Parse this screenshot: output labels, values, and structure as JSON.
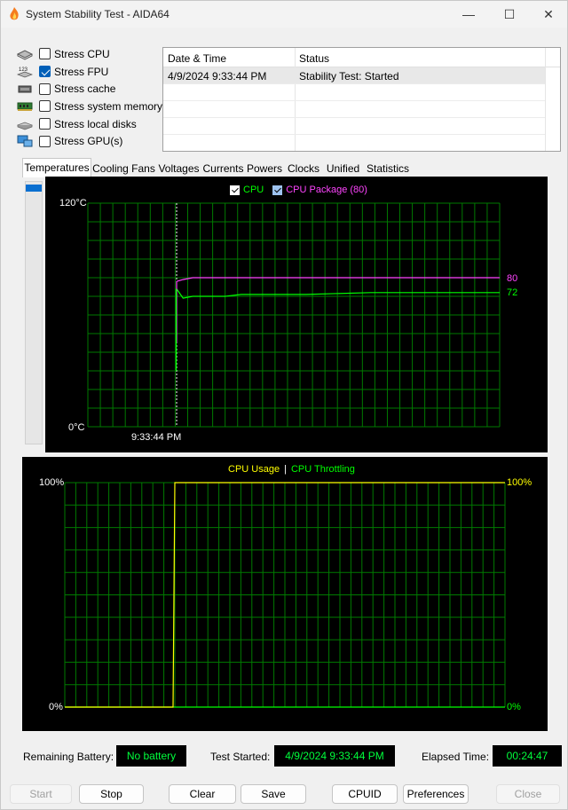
{
  "window": {
    "title": "System Stability Test - AIDA64",
    "min_glyph": "—",
    "max_glyph": "☐",
    "close_glyph": "✕"
  },
  "stress_options": [
    {
      "label": "Stress CPU",
      "checked": false,
      "icon": "cpu-chip-icon"
    },
    {
      "label": "Stress FPU",
      "checked": true,
      "icon": "fpu-123-icon"
    },
    {
      "label": "Stress cache",
      "checked": false,
      "icon": "cache-chip-icon"
    },
    {
      "label": "Stress system memory",
      "checked": false,
      "icon": "memory-module-icon"
    },
    {
      "label": "Stress local disks",
      "checked": false,
      "icon": "disk-drive-icon"
    },
    {
      "label": "Stress GPU(s)",
      "checked": false,
      "icon": "gpu-monitor-icon"
    }
  ],
  "log": {
    "columns": [
      "Date & Time",
      "Status"
    ],
    "rows": [
      {
        "time": "4/9/2024 9:33:44 PM",
        "status": "Stability Test: Started"
      }
    ]
  },
  "tabs": [
    "Temperatures",
    "Cooling Fans",
    "Voltages",
    "Currents",
    "Powers",
    "Clocks",
    "Unified",
    "Statistics"
  ],
  "active_tab": "Temperatures",
  "temperature_graph": {
    "legend": [
      {
        "label": "CPU",
        "color": "#00ff00",
        "checked": true
      },
      {
        "label": "CPU Package (80)",
        "color": "#ff44ff",
        "checked": true
      }
    ],
    "y_max_label": "120°C",
    "y_min_label": "0°C",
    "x_label": "9:33:44 PM",
    "right_labels": [
      {
        "text": "80",
        "color": "#ff44ff"
      },
      {
        "text": "72",
        "color": "#00ff00"
      }
    ]
  },
  "cpu_graph": {
    "legend_usage": "CPU Usage",
    "legend_sep": "|",
    "legend_throttling": "CPU Throttling",
    "left_top": "100%",
    "left_bottom": "0%",
    "right_top": "100%",
    "right_bottom": "0%"
  },
  "chart_data": [
    {
      "type": "line",
      "ylim": [
        0,
        120
      ],
      "series": [
        {
          "name": "CPU",
          "color": "#00ff00",
          "points": [
            [
              0,
              74
            ],
            [
              2,
              69
            ],
            [
              5,
              70
            ],
            [
              15,
              70
            ],
            [
              20,
              71
            ],
            [
              40,
              71
            ],
            [
              60,
              72
            ],
            [
              100,
              72
            ]
          ]
        },
        {
          "name": "CPU Package (80)",
          "color": "#ff44ff",
          "points": [
            [
              0,
              78
            ],
            [
              2,
              79
            ],
            [
              5,
              80
            ],
            [
              100,
              80
            ]
          ]
        }
      ]
    },
    {
      "type": "line",
      "ylim": [
        0,
        100
      ],
      "series": [
        {
          "name": "CPU Usage",
          "color": "#ffff00",
          "values": [
            0,
            100
          ]
        },
        {
          "name": "CPU Throttling",
          "color": "#00ff00",
          "values": [
            0,
            0
          ]
        }
      ]
    }
  ],
  "status": {
    "battery_label": "Remaining Battery:",
    "battery_value": "No battery",
    "started_label": "Test Started:",
    "started_value": "4/9/2024 9:33:44 PM",
    "elapsed_label": "Elapsed Time:",
    "elapsed_value": "00:24:47"
  },
  "buttons": {
    "start": "Start",
    "stop": "Stop",
    "clear": "Clear",
    "save": "Save",
    "cpuid": "CPUID",
    "preferences": "Preferences",
    "close": "Close"
  }
}
